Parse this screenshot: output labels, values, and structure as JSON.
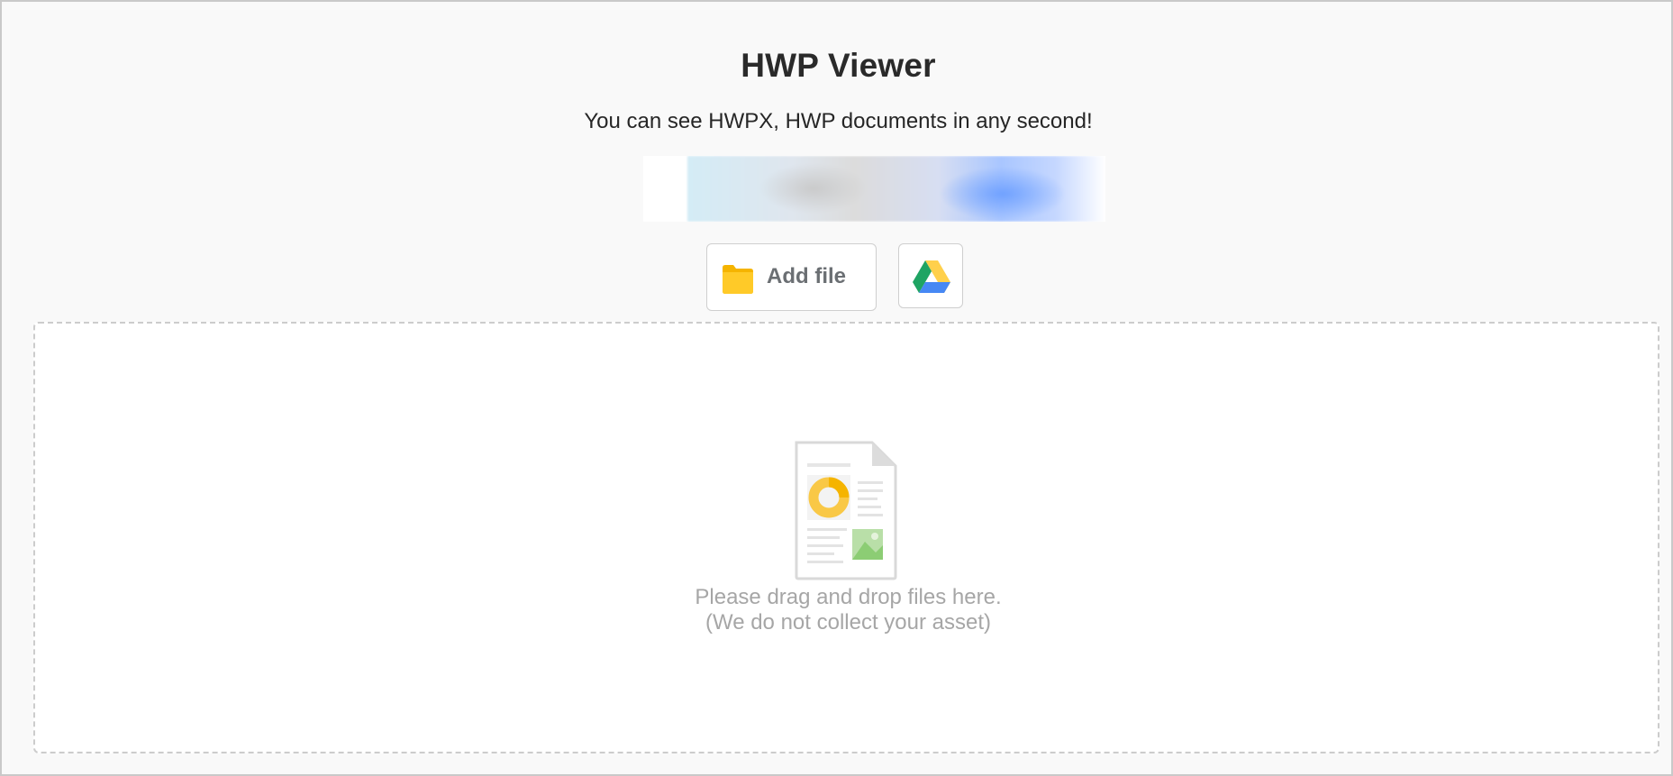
{
  "header": {
    "title": "HWP Viewer",
    "subtitle": "You can see HWPX, HWP documents in any second!"
  },
  "toolbar": {
    "add_file_label": "Add file",
    "folder_icon": "folder-icon",
    "drive_icon": "google-drive-icon"
  },
  "dropzone": {
    "line1": "Please drag and drop files here.",
    "line2": "(We do not collect your asset)",
    "illustration_icon": "document-icon"
  },
  "colors": {
    "folder": "#ffc107",
    "drive_green": "#1fa463",
    "drive_yellow": "#ffd04b",
    "drive_blue": "#4688f4"
  }
}
